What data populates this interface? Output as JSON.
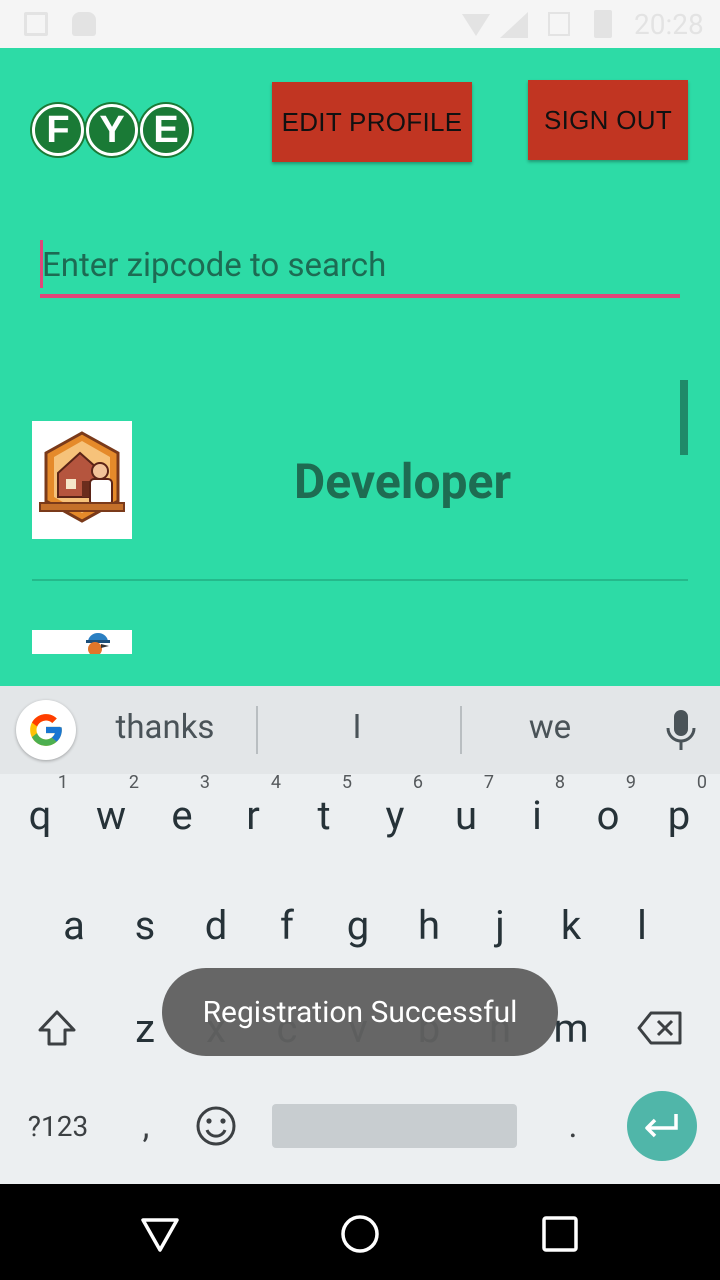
{
  "status_bar": {
    "time": "20:28",
    "icons": [
      "gallery-icon",
      "android-icon",
      "wifi-icon",
      "signal-icon",
      "sim-icon",
      "battery-icon"
    ]
  },
  "header": {
    "logo_letters": [
      "F",
      "Y",
      "E"
    ],
    "edit_profile_label": "EDIT PROFILE",
    "sign_out_label": "SIGN OUT"
  },
  "search": {
    "placeholder": "Enter zipcode to search",
    "value": ""
  },
  "list": {
    "items": [
      {
        "title": "Developer",
        "thumbnail": "developer-thumbnail"
      },
      {
        "title": "",
        "thumbnail": "worker-thumbnail"
      }
    ]
  },
  "keyboard": {
    "suggestions": [
      "thanks",
      "I",
      "we"
    ],
    "row1": [
      {
        "key": "q",
        "hint": "1"
      },
      {
        "key": "w",
        "hint": "2"
      },
      {
        "key": "e",
        "hint": "3"
      },
      {
        "key": "r",
        "hint": "4"
      },
      {
        "key": "t",
        "hint": "5"
      },
      {
        "key": "y",
        "hint": "6"
      },
      {
        "key": "u",
        "hint": "7"
      },
      {
        "key": "i",
        "hint": "8"
      },
      {
        "key": "o",
        "hint": "9"
      },
      {
        "key": "p",
        "hint": "0"
      }
    ],
    "row2": [
      "a",
      "s",
      "d",
      "f",
      "g",
      "h",
      "j",
      "k",
      "l"
    ],
    "row3": [
      "z",
      "x",
      "c",
      "v",
      "b",
      "n",
      "m"
    ],
    "symbols_label": "?123",
    "comma_label": ",",
    "period_label": "."
  },
  "toast": {
    "message": "Registration Successful"
  },
  "colors": {
    "background": "#2ddba6",
    "button": "#c13522",
    "accent": "#e0467a",
    "title": "#1e6c52"
  }
}
